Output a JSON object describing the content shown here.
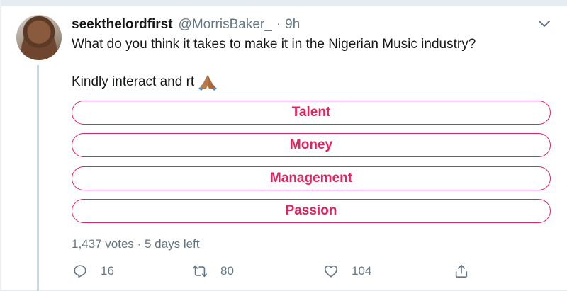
{
  "tweet": {
    "display_name": "seekthelordfirst",
    "handle": "@MorrisBaker_",
    "separator": "·",
    "time": "9h",
    "text_line1": "What do you think it takes to make it in the Nigerian Music industry?",
    "text_line2": "Kindly interact and rt",
    "emoji_icon": "folded-hands-icon"
  },
  "poll": {
    "options": [
      {
        "label": "Talent"
      },
      {
        "label": "Money"
      },
      {
        "label": "Management"
      },
      {
        "label": "Passion"
      }
    ],
    "meta": "1,437 votes · 5 days left",
    "accent_color": "#e0245e"
  },
  "actions": {
    "reply_count": "16",
    "retweet_count": "80",
    "like_count": "104",
    "icons": [
      "reply-icon",
      "retweet-icon",
      "like-icon",
      "share-icon"
    ]
  }
}
